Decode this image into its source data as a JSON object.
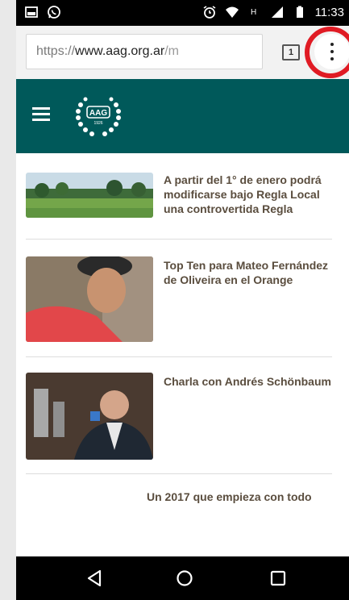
{
  "status_bar": {
    "time": "11:33",
    "icons": [
      "image-icon",
      "whatsapp-icon",
      "alarm-icon",
      "wifi-icon",
      "hspa-icon",
      "signal-icon",
      "battery-icon"
    ]
  },
  "browser": {
    "url_scheme": "https://",
    "url_host": "www.aag.org.ar",
    "url_path": "/m",
    "tab_count": "1",
    "menu_icon": "overflow-menu-icon"
  },
  "site": {
    "logo_text": "AAG",
    "logo_year": "1926",
    "colors": {
      "header": "#00595a",
      "title_text": "#5a4d3e",
      "highlight_ring": "#e01b24"
    }
  },
  "articles": [
    {
      "title": "A partir del 1° de enero podrá modificarse bajo Regla Local una controvertida Regla",
      "thumb": "golf-course-photo"
    },
    {
      "title": "Top Ten para Mateo Fernández de Oliveira en el Orange",
      "thumb": "golfer-portrait-photo"
    },
    {
      "title": "Charla con Andrés Schönbaum",
      "thumb": "man-in-suit-photo"
    },
    {
      "title": "Un 2017 que empieza con todo"
    }
  ],
  "nav_bar": {
    "icons": [
      "back-icon",
      "home-icon",
      "recents-icon"
    ]
  }
}
